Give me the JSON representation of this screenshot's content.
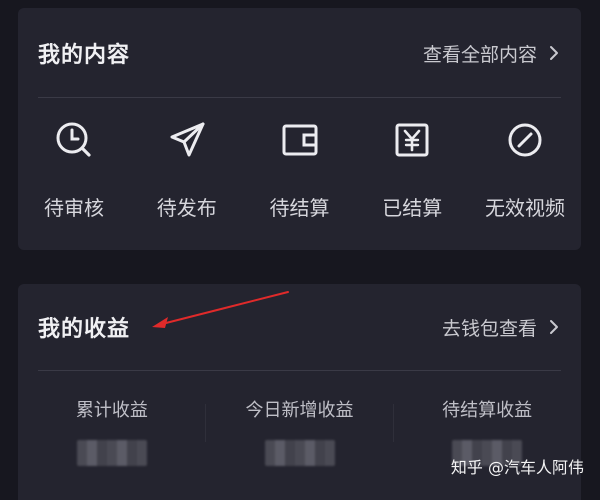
{
  "my_content": {
    "title": "我的内容",
    "view_all_label": "查看全部内容",
    "items": [
      {
        "label": "待审核",
        "icon": "clock-search-icon"
      },
      {
        "label": "待发布",
        "icon": "paper-plane-icon"
      },
      {
        "label": "待结算",
        "icon": "wallet-icon"
      },
      {
        "label": "已结算",
        "icon": "yen-ledger-icon"
      },
      {
        "label": "无效视频",
        "icon": "invalid-slash-circle-icon"
      }
    ]
  },
  "my_earnings": {
    "title": "我的收益",
    "wallet_link_label": "去钱包查看",
    "stats": [
      {
        "label": "累计收益"
      },
      {
        "label": "今日新增收益"
      },
      {
        "label": "待结算收益"
      }
    ]
  },
  "watermark": "知乎 @汽车人阿伟",
  "colors": {
    "background": "#17171f",
    "card": "#24242f",
    "annotation_arrow": "#e02a2a"
  }
}
